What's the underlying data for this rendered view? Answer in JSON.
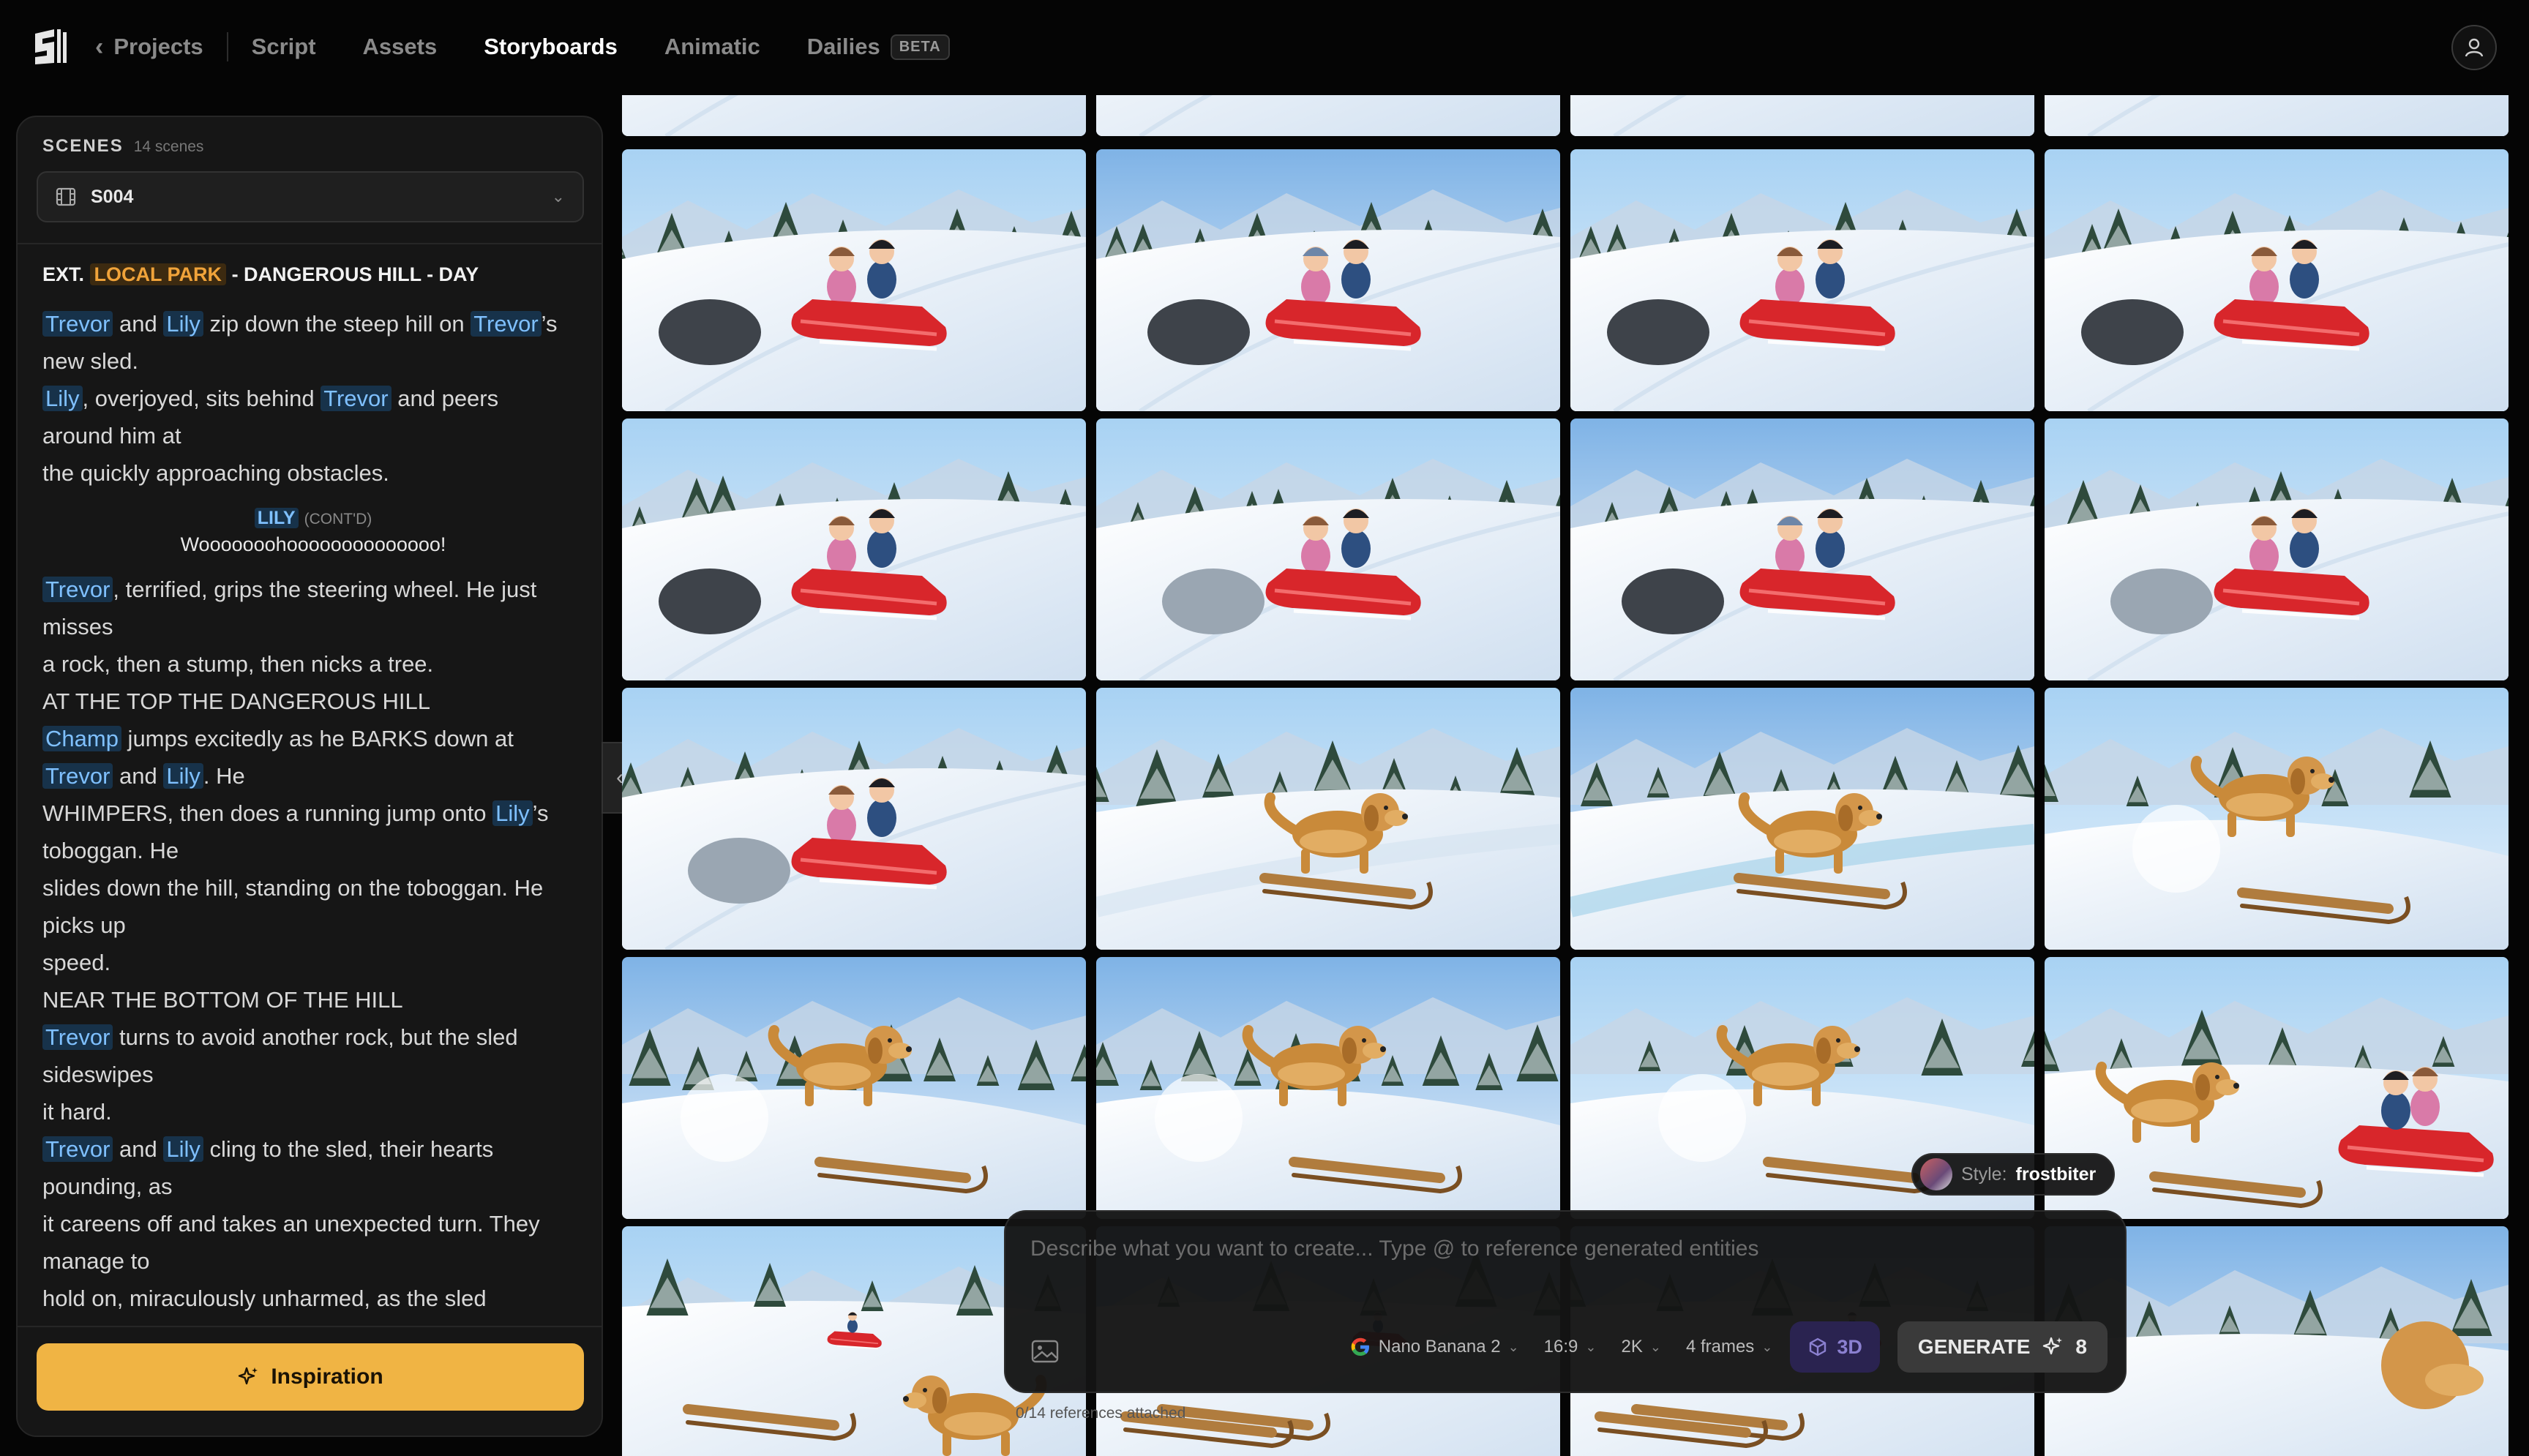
{
  "nav": {
    "back_label": "Projects",
    "items": [
      {
        "label": "Script",
        "active": false
      },
      {
        "label": "Assets",
        "active": false
      },
      {
        "label": "Storyboards",
        "active": true
      },
      {
        "label": "Animatic",
        "active": false
      },
      {
        "label": "Dailies",
        "active": false,
        "badge": "BETA"
      }
    ],
    "icons": {
      "logo": "app-logo-icon",
      "back": "chevron-left-icon",
      "user": "user-icon"
    }
  },
  "scenes": {
    "title": "SCENES",
    "count": "14 scenes",
    "selected": "S004"
  },
  "script": {
    "slug_prefix": "EXT.",
    "slug_location": "LOCAL PARK",
    "slug_suffix": "- DANGEROUS HILL - DAY",
    "block1": [
      [
        "Trevor",
        " and ",
        "Lily",
        " zip down the steep hill on ",
        "Trevor",
        "’s"
      ],
      [
        "new sled."
      ],
      [
        "Lily",
        ", overjoyed, sits behind ",
        "Trevor",
        " and peers"
      ],
      [
        "around him at"
      ],
      [
        "the quickly approaching obstacles."
      ]
    ],
    "dialog_name": "LILY",
    "dialog_cont": "(CONT'D)",
    "dialog_text": "Wooooooohoooooooooooooo!",
    "block2": [
      [
        "Trevor",
        ", terrified, grips the steering wheel. He just"
      ],
      [
        "misses"
      ],
      [
        "a rock, then a stump, then nicks a tree."
      ],
      [
        "AT THE TOP THE DANGEROUS HILL"
      ],
      [
        "Champ",
        " jumps excitedly as he BARKS down at"
      ],
      [
        "Trevor",
        " and ",
        "Lily",
        ". He"
      ],
      [
        "WHIMPERS, then does a running jump onto ",
        "Lily",
        "’s"
      ],
      [
        "toboggan. He"
      ],
      [
        "slides down the hill, standing on the toboggan. He"
      ],
      [
        "picks up"
      ],
      [
        "speed."
      ],
      [
        "NEAR THE BOTTOM OF THE HILL"
      ],
      [
        "Trevor",
        " turns to avoid another rock, but the sled"
      ],
      [
        "sideswipes"
      ],
      [
        "it hard."
      ],
      [
        "Trevor",
        " and ",
        "Lily",
        " cling to the sled, their hearts"
      ],
      [
        "pounding, as"
      ],
      [
        "it careens off and takes an unexpected turn. They"
      ],
      [
        "manage to"
      ],
      [
        "hold on, miraculously unharmed, as the sled"
      ]
    ],
    "characters": [
      "Trevor",
      "Lily",
      "Champ"
    ]
  },
  "inspiration_label": "Inspiration",
  "style_chip": {
    "key": "Style:",
    "value": "frostbiter"
  },
  "composer": {
    "placeholder": "Describe what you want to create... Type @ to reference generated entities",
    "model": "Nano Banana 2",
    "aspect": "16:9",
    "resolution": "2K",
    "frames": "4 frames",
    "mode_3d": "3D",
    "generate": "GENERATE",
    "credits": "8",
    "refs": "0/14 references attached"
  },
  "storyboard_frames": [
    {
      "kind": "sled-kids",
      "variant": 0
    },
    {
      "kind": "sled-kids",
      "variant": 1
    },
    {
      "kind": "sled-kids",
      "variant": 0
    },
    {
      "kind": "sled-kids",
      "variant": 0
    },
    {
      "kind": "sled-kids",
      "variant": 0
    },
    {
      "kind": "sled-kids",
      "variant": 2
    },
    {
      "kind": "sled-kids",
      "variant": 1
    },
    {
      "kind": "sled-kids",
      "variant": 2
    },
    {
      "kind": "sled-kids",
      "variant": 2
    },
    {
      "kind": "dog-sled",
      "variant": 0
    },
    {
      "kind": "dog-sled",
      "variant": 1
    },
    {
      "kind": "dog-jump",
      "variant": 0
    },
    {
      "kind": "dog-jump",
      "variant": 1
    },
    {
      "kind": "dog-jump",
      "variant": 1
    },
    {
      "kind": "dog-jump",
      "variant": 0
    },
    {
      "kind": "dog-stand",
      "variant": 0
    },
    {
      "kind": "wide",
      "variant": 0
    },
    {
      "kind": "wide",
      "variant": 1
    },
    {
      "kind": "wide",
      "variant": 1
    },
    {
      "kind": "dog-stand",
      "variant": 1
    }
  ],
  "colors": {
    "accent_inspiration": "#f0b444",
    "location_highlight": "#f0a33a",
    "character_highlight": "#7fc0ff",
    "sled_red": "#d8262b",
    "snow": "#eef4fb",
    "sky": "#9cc8ef"
  }
}
